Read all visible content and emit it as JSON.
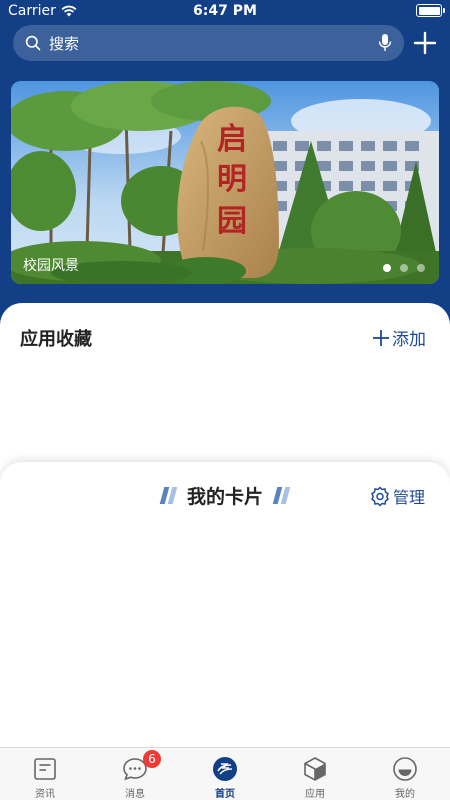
{
  "status_bar": {
    "carrier": "Carrier",
    "time": "6:47 PM"
  },
  "search": {
    "placeholder": "搜索"
  },
  "banner": {
    "caption": "校园风景",
    "stone_text": "启明园",
    "slide_count": 3,
    "active_slide": 1
  },
  "favorites": {
    "title": "应用收藏",
    "add_label": "添加"
  },
  "cards": {
    "title": "我的卡片",
    "manage_label": "管理"
  },
  "tabs": [
    {
      "label": "资讯",
      "icon": "news-icon"
    },
    {
      "label": "消息",
      "icon": "message-icon",
      "badge": "6"
    },
    {
      "label": "首页",
      "icon": "home-logo-icon",
      "active": true
    },
    {
      "label": "应用",
      "icon": "apps-box-icon"
    },
    {
      "label": "我的",
      "icon": "profile-icon"
    }
  ],
  "colors": {
    "primary": "#123f86",
    "accent_text": "#1d4b93",
    "badge": "#f03a35"
  }
}
